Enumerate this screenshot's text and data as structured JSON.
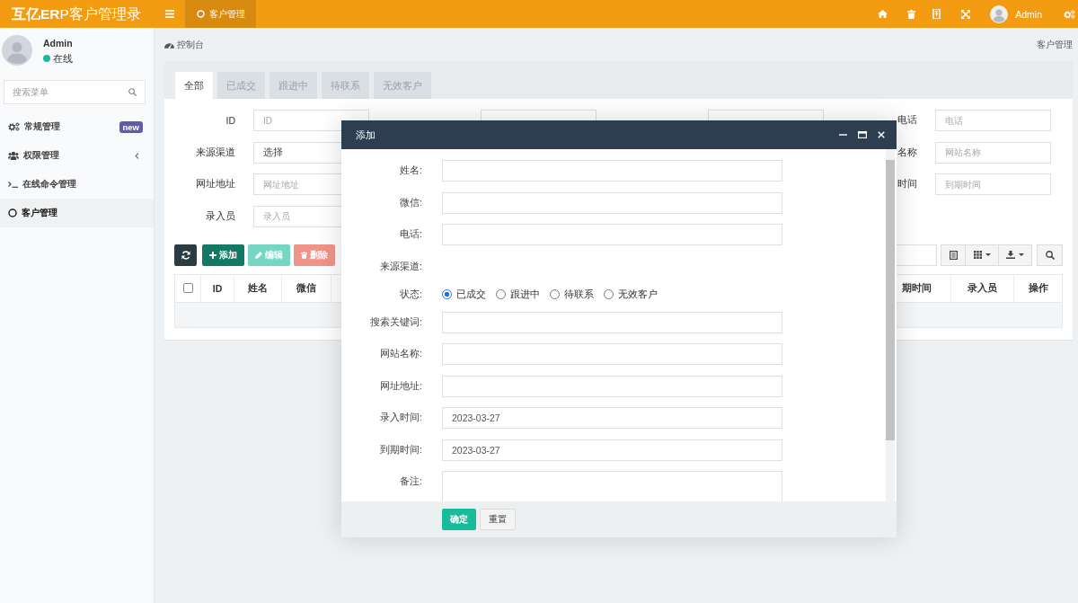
{
  "header": {
    "logo": "**互亿ER**P客户管理录",
    "tabs": [
      {
        "label": "客户管理",
        "selected": true
      }
    ],
    "user_name": "Admin"
  },
  "sidebar": {
    "user": {
      "name": "Admin",
      "status": "在线"
    },
    "search": {
      "placeholder": "搜索菜单"
    },
    "items": [
      {
        "label": "常规管理",
        "badge": "new",
        "has_submenu": false,
        "selected": false
      },
      {
        "label": "权限管理",
        "has_submenu": true,
        "selected": false
      },
      {
        "label": "在线命令管理",
        "has_submenu": false,
        "selected": false
      },
      {
        "label": "客户管理",
        "has_submenu": false,
        "selected": true
      }
    ]
  },
  "breadcrumb": {
    "home": "控制台",
    "current": "客户管理"
  },
  "panel": {
    "tabs": [
      {
        "label": "全部",
        "selected": true
      },
      {
        "label": "已成交",
        "selected": false
      },
      {
        "label": "跟进中",
        "selected": false
      },
      {
        "label": "待联系",
        "selected": false
      },
      {
        "label": "无效客户",
        "selected": false
      }
    ],
    "filters": [
      {
        "kind": "input",
        "label": "ID",
        "placeholder": "ID"
      },
      {
        "kind": "input"
      },
      {
        "kind": "input"
      },
      {
        "kind": "input",
        "label": "电话",
        "placeholder": "电话"
      },
      {
        "kind": "select",
        "label": "来源渠道",
        "value": "选择"
      },
      {
        "kind": "covered"
      },
      {
        "kind": "covered"
      },
      {
        "kind": "input",
        "label": "名称",
        "placeholder": "网站名称"
      },
      {
        "kind": "input",
        "label": "网址地址",
        "placeholder": "网址地址"
      },
      {
        "kind": "covered"
      },
      {
        "kind": "covered"
      },
      {
        "kind": "input",
        "label": "时间",
        "placeholder": "到期时间"
      },
      {
        "kind": "input",
        "label": "录入员",
        "placeholder": "录入员"
      }
    ],
    "toolbar": {
      "buttons": [
        {
          "kind": "refresh",
          "disabled": false
        },
        {
          "kind": "add",
          "label": "添加",
          "disabled": false
        },
        {
          "kind": "edit",
          "label": "编辑",
          "disabled": true
        },
        {
          "kind": "delete",
          "label": "删除",
          "disabled": true
        }
      ],
      "has_search": true
    },
    "table": {
      "select_all": {
        "checked": false
      },
      "columns": [
        {
          "kind": "text",
          "label": "ID"
        },
        {
          "kind": "text",
          "label": "姓名"
        },
        {
          "kind": "text",
          "label": "微信"
        },
        {
          "kind": "covered"
        },
        {
          "kind": "text",
          "label": "期时间"
        },
        {
          "kind": "text",
          "label": "录入员"
        },
        {
          "kind": "text",
          "label": "操作"
        }
      ]
    }
  },
  "dialog": {
    "title": "添加",
    "fields": [
      {
        "kind": "input",
        "label": "姓名:"
      },
      {
        "kind": "input",
        "label": "微信:"
      },
      {
        "kind": "input",
        "label": "电话:"
      },
      {
        "kind": "label_only",
        "label": "来源渠道:"
      },
      {
        "kind": "radio",
        "label": "状态:",
        "options": [
          {
            "label": "已成交",
            "selected": true
          },
          {
            "label": "跟进中",
            "selected": false
          },
          {
            "label": "待联系",
            "selected": false
          },
          {
            "label": "无效客户",
            "selected": false
          }
        ]
      },
      {
        "kind": "input",
        "label": "搜索关键词:"
      },
      {
        "kind": "input",
        "label": "网站名称:"
      },
      {
        "kind": "input",
        "label": "网址地址:"
      },
      {
        "kind": "input",
        "label": "录入时间:",
        "value": "2023-03-27"
      },
      {
        "kind": "input",
        "label": "到期时间:",
        "value": "2023-03-27"
      },
      {
        "kind": "textarea",
        "label": "备注:"
      }
    ],
    "buttons": [
      {
        "kind": "primary",
        "label": "确定"
      },
      {
        "kind": "default",
        "label": "重置"
      }
    ]
  }
}
